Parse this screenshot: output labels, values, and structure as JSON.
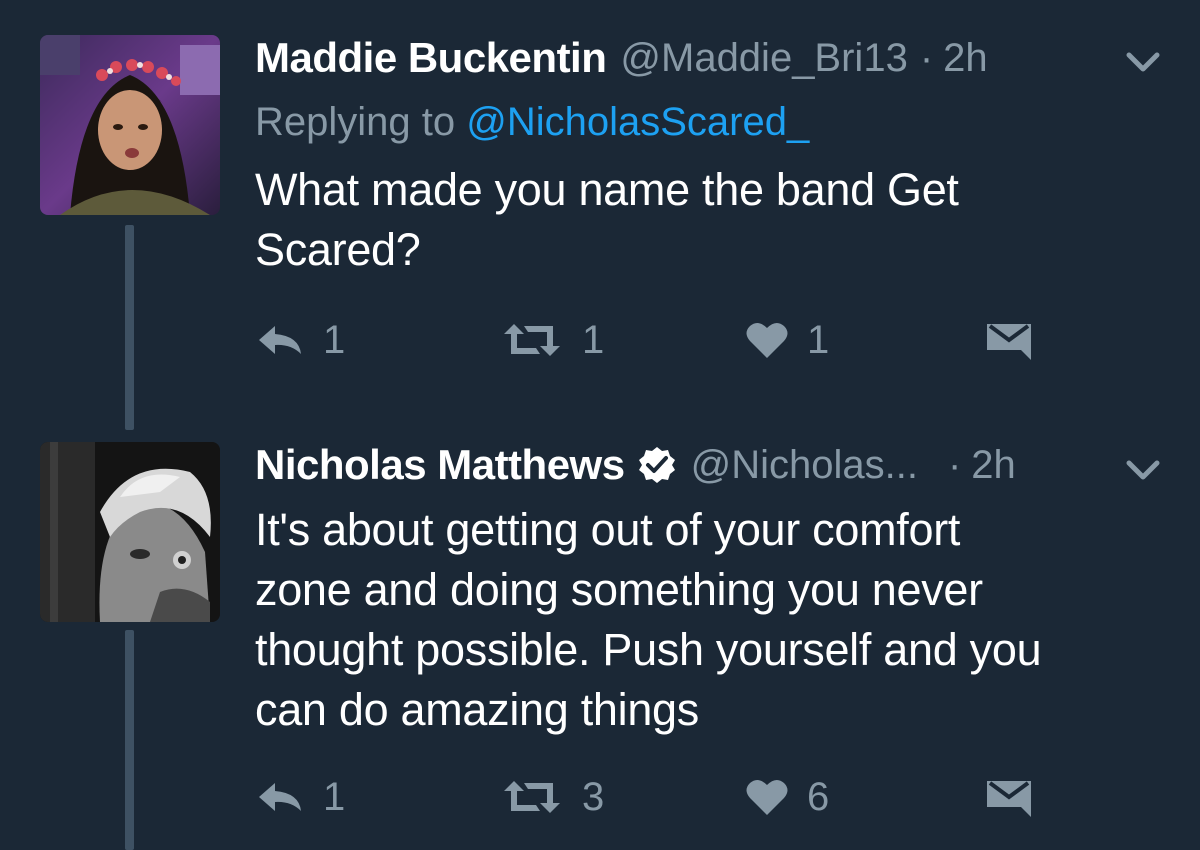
{
  "thread": {
    "tweets": [
      {
        "display_name": "Maddie Buckentin",
        "handle": "@Maddie_Bri13",
        "separator": "·",
        "time": "2h",
        "replying_to_label": "Replying to",
        "replying_to_handle": "@NicholasScared_",
        "text_lines": [
          "What made you name the band Get",
          "Scared?"
        ],
        "actions": {
          "reply_count": "1",
          "retweet_count": "1",
          "like_count": "1"
        }
      },
      {
        "display_name": "Nicholas Matthews",
        "verified": true,
        "handle": "@Nicholas...",
        "separator": "·",
        "time": "2h",
        "text_lines": [
          "It's about getting out of your comfort",
          "zone and doing something you never",
          "thought possible. Push yourself and you",
          "can do amazing things"
        ],
        "actions": {
          "reply_count": "1",
          "retweet_count": "3",
          "like_count": "6"
        }
      }
    ]
  },
  "icons": {
    "reply": "reply-icon",
    "retweet": "retweet-icon",
    "like": "heart-icon",
    "dm": "direct-message-icon",
    "menu": "chevron-down-icon",
    "verified": "verified-badge-icon"
  },
  "colors": {
    "background": "#1b2836",
    "muted": "#8899a6",
    "link": "#1da1f2",
    "thread_line": "#3e5163",
    "icon": "#8899a6"
  }
}
